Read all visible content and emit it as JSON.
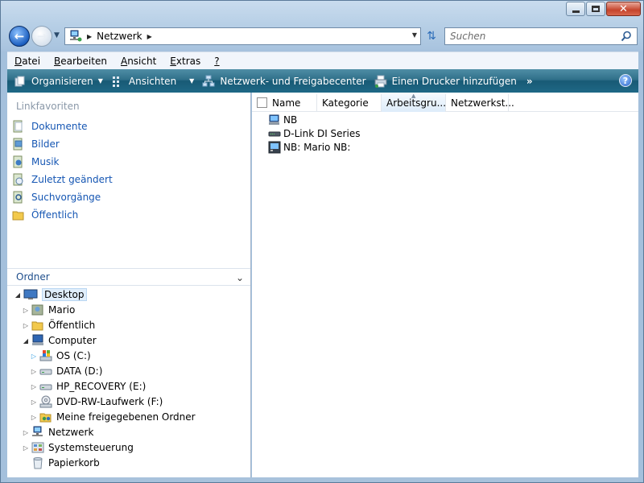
{
  "window": {
    "minimize_icon": "minimize-icon",
    "maximize_icon": "maximize-icon",
    "close_glyph": "✕"
  },
  "nav": {
    "back_icon": "back-arrow-icon",
    "forward_icon": "forward-arrow-icon",
    "address_text": "Netzwerk",
    "search_placeholder": "Suchen"
  },
  "menu": {
    "items": [
      "Datei",
      "Bearbeiten",
      "Ansicht",
      "Extras",
      "?"
    ],
    "mnemonics": [
      "D",
      "B",
      "A",
      "E",
      "?"
    ],
    "rests": [
      "atei",
      "earbeiten",
      "nsicht",
      "xtras",
      ""
    ]
  },
  "commandbar": {
    "organize": "Organisieren",
    "views": "Ansichten",
    "network_center": "Netzwerk- und Freigabecenter",
    "add_printer": "Einen Drucker hinzufügen",
    "more": "»",
    "help": "?"
  },
  "favorites": {
    "header": "Linkfavoriten",
    "items": [
      {
        "label": "Dokumente",
        "icon": "documents-icon"
      },
      {
        "label": "Bilder",
        "icon": "pictures-icon"
      },
      {
        "label": "Musik",
        "icon": "music-icon"
      },
      {
        "label": "Zuletzt geändert",
        "icon": "recent-icon"
      },
      {
        "label": "Suchvorgänge",
        "icon": "searches-icon"
      },
      {
        "label": "Öffentlich",
        "icon": "public-folder-icon"
      }
    ]
  },
  "folders": {
    "header": "Ordner",
    "tree": [
      {
        "label": "Desktop",
        "icon": "desktop-icon",
        "expanded": true,
        "selected": true
      },
      {
        "label": "Mario",
        "icon": "user-folder-icon"
      },
      {
        "label": "Öffentlich",
        "icon": "public-folder-icon"
      },
      {
        "label": "Computer",
        "icon": "computer-icon",
        "expanded": true
      },
      {
        "label": "OS (C:)",
        "icon": "windows-drive-icon"
      },
      {
        "label": "DATA (D:)",
        "icon": "drive-icon"
      },
      {
        "label": "HP_RECOVERY (E:)",
        "icon": "drive-icon"
      },
      {
        "label": "DVD-RW-Laufwerk (F:)",
        "icon": "dvd-drive-icon"
      },
      {
        "label": "Meine freigegebenen Ordner",
        "icon": "shared-folders-icon"
      },
      {
        "label": "Netzwerk",
        "icon": "network-icon"
      },
      {
        "label": "Systemsteuerung",
        "icon": "control-panel-icon"
      },
      {
        "label": "Papierkorb",
        "icon": "recycle-bin-icon"
      }
    ]
  },
  "content": {
    "columns": [
      "Name",
      "Kategorie",
      "Arbeitsgru...",
      "Netzwerkst..."
    ],
    "items": [
      {
        "label": "NB",
        "icon": "network-computer-icon"
      },
      {
        "label": "D-Link DI Series",
        "icon": "router-icon"
      },
      {
        "label": "NB: Mario NB:",
        "icon": "media-device-icon"
      }
    ]
  }
}
